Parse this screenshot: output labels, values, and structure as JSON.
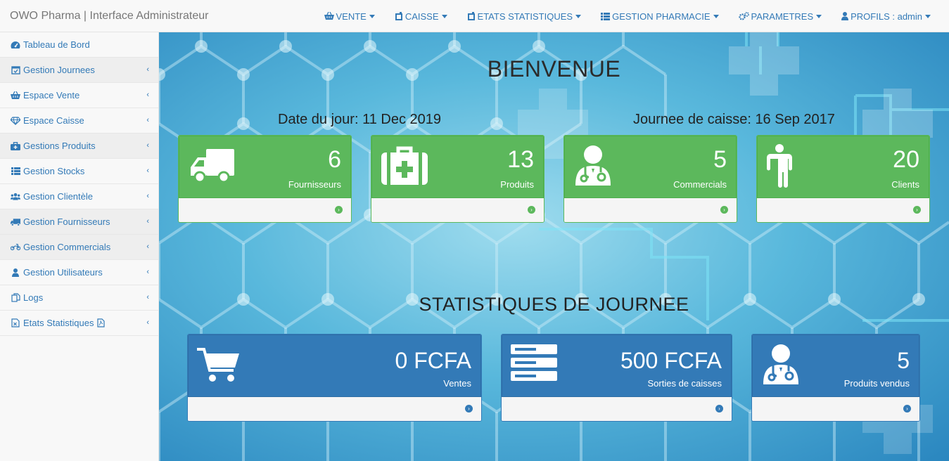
{
  "navbar": {
    "brand": "OWO Pharma | Interface Administrateur",
    "menu": [
      {
        "label": "VENTE",
        "icon": "basket-icon"
      },
      {
        "label": "CAISSE",
        "icon": "cash-register-icon"
      },
      {
        "label": "ETATS STATISTIQUES",
        "icon": "stats-icon"
      },
      {
        "label": "GESTION PHARMACIE",
        "icon": "list-icon"
      },
      {
        "label": "PARAMETRES",
        "icon": "gears-icon"
      },
      {
        "label": "PROFILS : admin",
        "icon": "user-icon"
      }
    ]
  },
  "sidebar": {
    "items": [
      {
        "label": "Tableau de Bord",
        "icon": "dashboard-icon"
      },
      {
        "label": "Gestion Journees",
        "icon": "calendar-check-icon"
      },
      {
        "label": "Espace Vente",
        "icon": "basket-icon"
      },
      {
        "label": "Espace Caisse",
        "icon": "diamond-icon"
      },
      {
        "label": "Gestions Produits",
        "icon": "briefcase-medical-icon"
      },
      {
        "label": "Gestion Stocks",
        "icon": "list-icon"
      },
      {
        "label": "Gestion Clientèle",
        "icon": "users-icon"
      },
      {
        "label": "Gestion Fournisseurs",
        "icon": "truck-icon"
      },
      {
        "label": "Gestion Commercials",
        "icon": "motorcycle-icon"
      },
      {
        "label": "Gestion Utilisateurs",
        "icon": "user-icon"
      },
      {
        "label": "Logs",
        "icon": "copy-icon"
      },
      {
        "label": "Etats Statistiques",
        "icon": "file-excel-icon"
      }
    ]
  },
  "main": {
    "welcome": "BIENVENUE",
    "date_du_jour": "Date du jour: 11 Dec 2019",
    "journee_caisse": "Journee de caisse: 16 Sep 2017",
    "top_cards": [
      {
        "value": "6",
        "label": "Fournisseurs",
        "icon": "truck-icon"
      },
      {
        "value": "13",
        "label": "Produits",
        "icon": "medkit-icon"
      },
      {
        "value": "5",
        "label": "Commercials",
        "icon": "user-md-icon"
      },
      {
        "value": "20",
        "label": "Clients",
        "icon": "male-icon"
      }
    ],
    "stats_title": "STATISTIQUES DE JOURNEE",
    "stat_cards": [
      {
        "value": "0 FCFA",
        "label": "Ventes",
        "icon": "cart-icon"
      },
      {
        "value": "500 FCFA",
        "label": "Sorties de caisses",
        "icon": "server-icon"
      },
      {
        "value": "5",
        "label": "Produits vendus",
        "icon": "user-md-icon"
      }
    ]
  },
  "colors": {
    "green": "#5cb85c",
    "blue": "#337ab7",
    "link": "#337ab7"
  }
}
